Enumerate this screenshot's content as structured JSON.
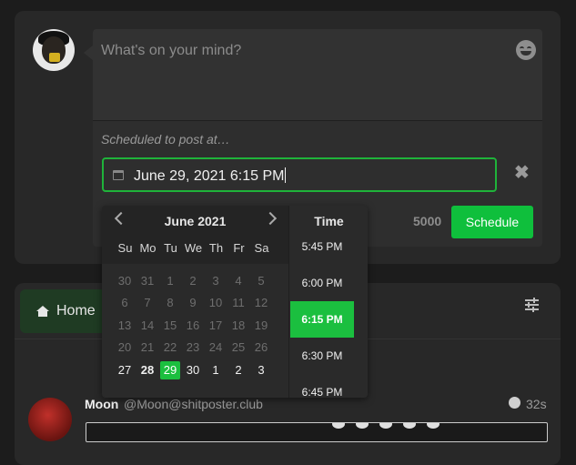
{
  "composer": {
    "placeholder": "What's on your mind?",
    "schedule_label": "Scheduled to post at…",
    "datetime_value": "June 29, 2021 6:15 PM",
    "char_count": "5000",
    "schedule_button": "Schedule"
  },
  "datepicker": {
    "month_title": "June 2021",
    "time_header": "Time",
    "weekdays": [
      "Su",
      "Mo",
      "Tu",
      "We",
      "Th",
      "Fr",
      "Sa"
    ],
    "weeks": [
      [
        "30",
        "31",
        "1",
        "2",
        "3",
        "4",
        "5"
      ],
      [
        "6",
        "7",
        "8",
        "9",
        "10",
        "11",
        "12"
      ],
      [
        "13",
        "14",
        "15",
        "16",
        "17",
        "18",
        "19"
      ],
      [
        "20",
        "21",
        "22",
        "23",
        "24",
        "25",
        "26"
      ],
      [
        "27",
        "28",
        "29",
        "30",
        "1",
        "2",
        "3"
      ]
    ],
    "today": "28",
    "selected_day": "29",
    "times": [
      "5:45 PM",
      "6:00 PM",
      "6:15 PM",
      "6:30 PM",
      "6:45 PM"
    ],
    "selected_time": "6:15 PM"
  },
  "timeline": {
    "tab_home": "Home",
    "post": {
      "author": "Moon",
      "handle": "@Moon@shitposter.club",
      "time": "32s"
    }
  },
  "colors": {
    "accent_green": "#1bbf3f",
    "panel_bg": "#282828",
    "page_bg": "#1c1c1c"
  },
  "icons": [
    "calendar-icon",
    "emoji-icon",
    "close-icon",
    "home-icon",
    "filter-icon",
    "globe-icon",
    "chevron-left-icon",
    "chevron-right-icon"
  ]
}
